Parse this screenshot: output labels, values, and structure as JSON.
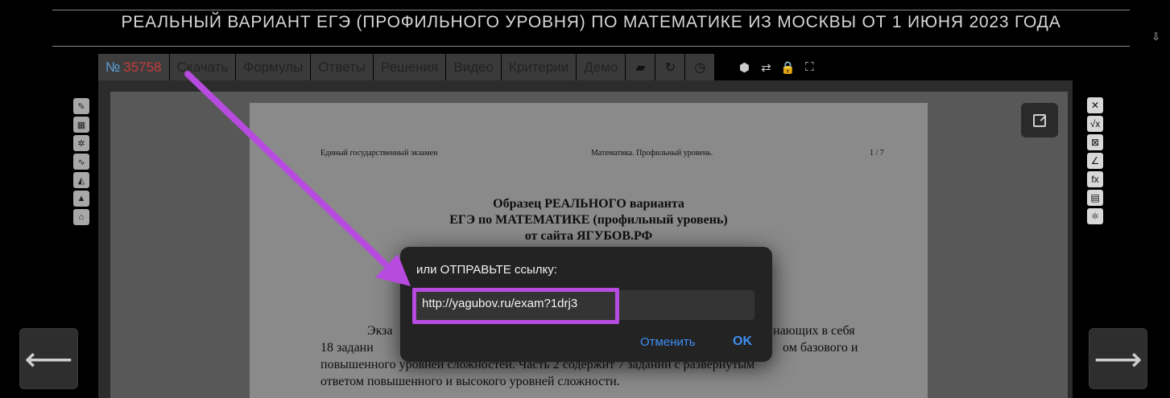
{
  "header": {
    "title": "РЕАЛЬНЫЙ ВАРИАНТ ЕГЭ (ПРОФИЛЬНОГО УРОВНЯ) ПО МАТЕМАТИКЕ ИЗ МОСКВЫ ОТ 1 ИЮНЯ 2023 ГОДА",
    "corner_icon": "⇩"
  },
  "toolbar": {
    "number_prefix": "№",
    "number_value": "35758",
    "items": [
      "Скачать",
      "Формулы",
      "Ответы",
      "Решения",
      "Видео",
      "Критерии",
      "Демо"
    ],
    "icons": [
      "▰",
      "↻",
      "◷"
    ],
    "small_icons": [
      "⬢",
      "⇄",
      "🔒",
      "⛶"
    ]
  },
  "paper": {
    "header_left": "Единый государственный экзамен",
    "header_center": "Математика. Профильный уровень.",
    "header_right": "1 / 7",
    "title_1": "Образец РЕАЛЬНОГО варианта",
    "title_2": "ЕГЭ по МАТЕМАТИКЕ (профильный уровень)",
    "title_3": "от сайта ЯГУБОВ.РФ",
    "body_1a": "Экза",
    "body_1b": "нающих в себя",
    "body_2a": "18 задани",
    "body_2b": "ом базового и",
    "body_3": "повышенного уровней сложностей. Часть 2 содержит 7 заданий с развёрнутым",
    "body_4": "ответом повышенного и высокого уровней сложности."
  },
  "left_tools": [
    "✎",
    "▦",
    "✲",
    "∿",
    "◭",
    "▲",
    "⌂"
  ],
  "right_tools": [
    "✕",
    "√x",
    "⊠",
    "∠",
    "fx",
    "▤",
    "⚛"
  ],
  "nav": {
    "prev": "⟵",
    "next": "⟶"
  },
  "dialog": {
    "prompt": "или ОТПРАВЬТЕ ссылку:",
    "url": "http://yagubov.ru/exam?1drj3",
    "cancel": "Отменить",
    "ok": "OK"
  },
  "colors": {
    "accent_purple": "#b84bdf",
    "link_blue": "#3d8ef3",
    "number_red": "#c63a3a"
  }
}
